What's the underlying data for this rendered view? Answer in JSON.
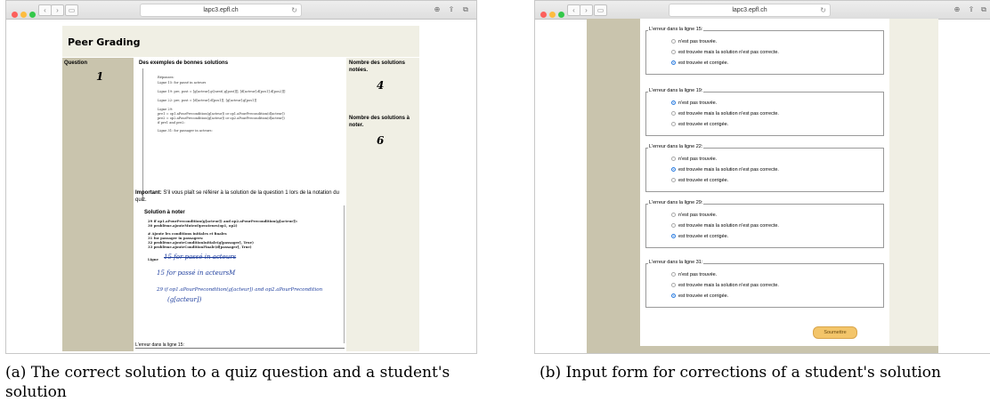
{
  "panel_a": {
    "url": "lapc3.epfl.ch",
    "page_title": "Peer Grading",
    "question_label": "Question",
    "question_number": "1",
    "examples_heading": "Des exemples de bonnes solutions",
    "graded_label": "Nombre des solutions notées.",
    "graded_count": "4",
    "to_grade_label": "Nombre des solutions à noter.",
    "to_grade_count": "6",
    "code_lines": [
      "Réponses:",
      "Ligne 15: for passé in acteurs",
      "Ligne 19: pre, post = [g[acteur].gQuest(.g[post]]], [d[acteur].d[pos1].d[pos2]]]",
      "Ligne 22: pre, post = [d[acteur].d[pos1]], [g[acteur].g[pos1]]",
      "Ligne 29:",
      "pre1 = op1.aPourPrecondition(g[acteur]) or op1.aPourPrecondition(d[acteur])",
      "pre2 = op2.aPourPrecondition(g[acteur]) or op2.aPourPrecondition(d[acteur])",
      "if pre1 and pre2:",
      "Ligne 31: for passager in acteurs:"
    ],
    "important_bold": "Important:",
    "important_text": " S'il vous plaît se référer à la solution de la question 1 lors de la notation du quiz.",
    "solution_heading": "Solution à noter",
    "student_lines": [
      "29          if op1.aPourPrecondition(g[acteur]) and op2.aPourPrecondition(g[acteur]):",
      "30              problème.ajouteMutexOperateurs(op1, op2)",
      "# Ajoute les conditions initiales et finales",
      "31 for passager in passagers:",
      "32     problème.ajouteConditionInitiale(g[passager], True)",
      "33     problème.ajouteConditionFinale(d[passager], True)",
      "Ligne"
    ],
    "handwriting": [
      "15  for  passé  in  acteurs",
      "15  for  passé  in  acteursM",
      "29  if  op1.aPourPrecondition(g[acteur])  and  op2.aPourPrecondition",
      "(g[acteur])"
    ],
    "bottom_label": "L'erreur dans la ligne 15:",
    "caption": "(a) The correct solution to a quiz question and a student's solution"
  },
  "panel_b": {
    "url": "lapc3.epfl.ch",
    "options": [
      "n'est pas trouvée.",
      "est trouvée mais la solution n'est pas correcte.",
      "est trouvée et corrigée."
    ],
    "fieldsets": [
      {
        "legend": "L'erreur dans la ligne 15:",
        "selected": 2
      },
      {
        "legend": "L'erreur dans la ligne 19:",
        "selected": 0
      },
      {
        "legend": "L'erreur dans la ligne 22:",
        "selected": 1
      },
      {
        "legend": "L'erreur dans la ligne 29:",
        "selected": 2
      },
      {
        "legend": "L'erreur dans la ligne 31:",
        "selected": 2
      }
    ],
    "submit_label": "Soumettre",
    "caption": "(b) Input form for corrections of a student's solution"
  }
}
